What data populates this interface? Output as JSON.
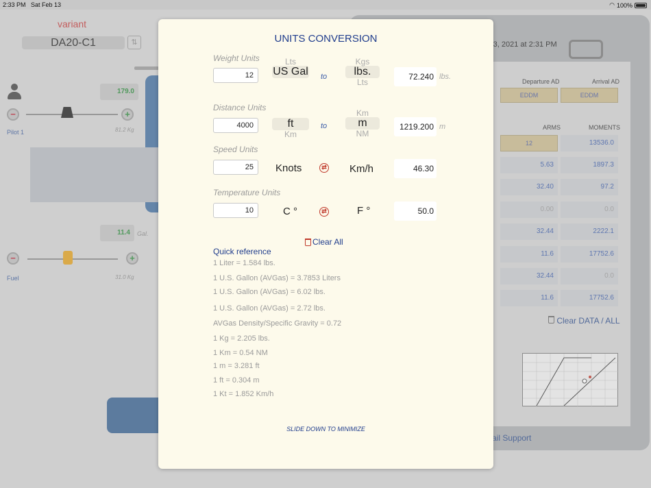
{
  "status": {
    "time": "2:33 PM",
    "date": "Sat Feb 13",
    "battery": "100%"
  },
  "background": {
    "variant_label": "variant",
    "aircraft": "DA20-C1",
    "pilot": {
      "label": "Pilot 1",
      "value": "179.0",
      "kg": "81.2 Kg"
    },
    "fuel": {
      "label": "Fuel",
      "value": "11.4",
      "unit": "Gal.",
      "kg": "31.0 Kg"
    },
    "clipboard": {
      "date": "y 13, 2021 at 2:31 PM",
      "departure_header": "Departure AD",
      "arrival_header": "Arrival AD",
      "departure": "EDDM",
      "arrival": "EDDM",
      "arms_header": "ARMS",
      "moments_header": "MOMENTS",
      "rows": [
        {
          "arm": "12",
          "moment": "13536.0"
        },
        {
          "arm": "5.63",
          "moment": "1897.3"
        },
        {
          "arm": "32.40",
          "moment": "97.2"
        },
        {
          "arm": "0.00",
          "moment": "0.0"
        },
        {
          "arm": "32.44",
          "moment": "2222.1"
        },
        {
          "arm": "11.6",
          "moment": "17752.6"
        },
        {
          "arm": "32.44",
          "moment": "0.0"
        },
        {
          "arm": "11.6",
          "moment": "17752.6"
        }
      ],
      "clear_data": "Clear DATA / ALL",
      "mail_support": "ail Support"
    }
  },
  "modal": {
    "title": "UNITS CONVERSION",
    "weight": {
      "label": "Weight Units",
      "input": "12",
      "from_above": "Lts",
      "from": "US Gal",
      "to_above": "Kgs",
      "to": "lbs.",
      "to_below": "Lts",
      "connector": "to",
      "result": "72.240",
      "suffix": "lbs."
    },
    "distance": {
      "label": "Distance Units",
      "input": "4000",
      "from": "ft",
      "from_below": "Km",
      "to_above": "Km",
      "to": "m",
      "to_below": "NM",
      "connector": "to",
      "result": "1219.200",
      "suffix": "m"
    },
    "speed": {
      "label": "Speed Units",
      "input": "25",
      "from": "Knots",
      "to": "Km/h",
      "result": "46.30"
    },
    "temperature": {
      "label": "Temperature Units",
      "input": "10",
      "from": "C °",
      "to": "F °",
      "result": "50.0"
    },
    "clear_all": "Clear All",
    "quick_reference": {
      "title": "Quick reference",
      "lines": [
        "1  Liter = 1.584 lbs.",
        "1  U.S. Gallon (AVGas) = 3.7853 Liters",
        "1  U.S. Gallon (AVGas) = 6.02 lbs.",
        "1  U.S. Gallon (AVGas) = 2.72 lbs.",
        "AVGas Density/Specific Gravity = 0.72",
        "1  Kg = 2.205 lbs.",
        "1  Km = 0.54 NM",
        "1  m = 3.281 ft",
        "1  ft = 0.304 m",
        "1  Kt = 1.852 Km/h"
      ]
    },
    "slide_hint": "SLIDE DOWN TO MINIMIZE"
  }
}
